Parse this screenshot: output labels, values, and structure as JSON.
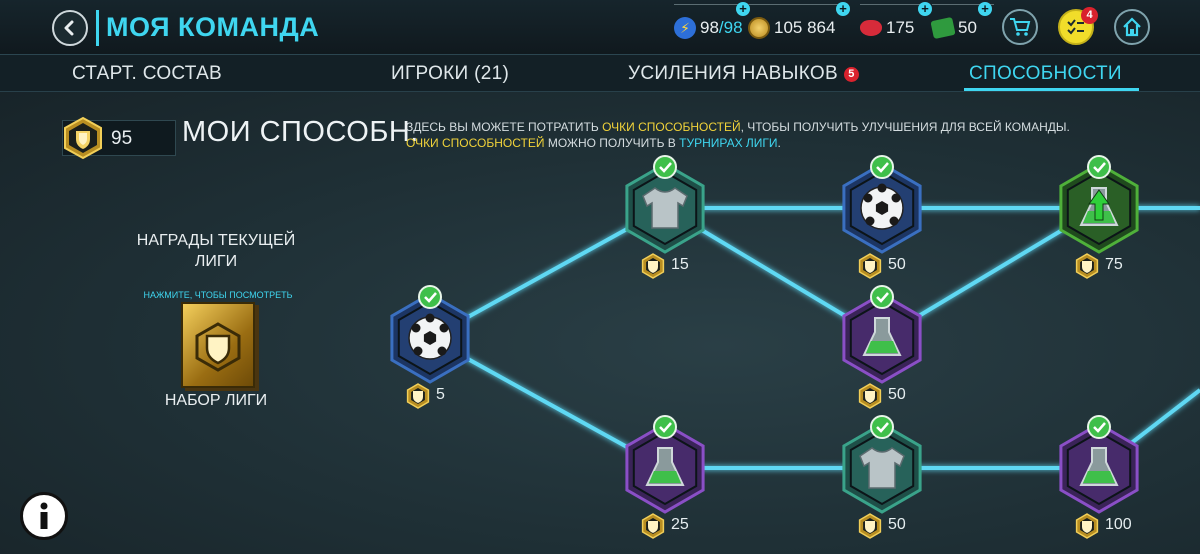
{
  "header": {
    "title": "МОЯ КОМАНДА",
    "energy": "98",
    "energy_max": "/98",
    "coins": "105 864",
    "gems": "175",
    "cash": "50",
    "notifications_count": "4"
  },
  "tabs": {
    "starting_lineup": "СТАРТ. СОСТАВ",
    "players": "ИГРОКИ (21)",
    "skill_boosts": "УСИЛЕНИЯ НАВЫКОВ",
    "skill_boosts_badge": "5",
    "abilities": "СПОСОБНОСТИ"
  },
  "abilities_header": {
    "points": "95",
    "title": "МОИ СПОСОБН.",
    "desc_line1_a": "ЗДЕСЬ ВЫ МОЖЕТЕ ПОТРАТИТЬ ",
    "desc_line1_highlight": "ОЧКИ СПОСОБНОСТЕЙ",
    "desc_line1_b": ", ЧТОБЫ ПОЛУЧИТЬ УЛУЧШЕНИЯ ДЛЯ ВСЕЙ КОМАНДЫ.",
    "desc_line2_highlight": "ОЧКИ СПОСОБНОСТЕЙ",
    "desc_line2_a": " МОЖНО ПОЛУЧИТЬ В ",
    "desc_line2_link": "ТУРНИРАХ ЛИГИ",
    "desc_line2_end": "."
  },
  "rewards": {
    "title": "НАГРАДЫ ТЕКУЩЕЙ ЛИГИ",
    "hint": "НАЖМИТЕ, ЧТОБЫ ПОСМОТРЕТЬ",
    "pack_label": "НАБОР ЛИГИ"
  },
  "nodes": [
    {
      "id": "n1",
      "icon": "ball-icon",
      "color": "blue",
      "cost": "5",
      "unlocked": true
    },
    {
      "id": "n2",
      "icon": "jersey-icon",
      "color": "teal",
      "cost": "15",
      "unlocked": true
    },
    {
      "id": "n3",
      "icon": "flask-icon",
      "color": "purple",
      "cost": "25",
      "unlocked": true
    },
    {
      "id": "n4",
      "icon": "ball-icon",
      "color": "blue",
      "cost": "50",
      "unlocked": true
    },
    {
      "id": "n5",
      "icon": "flask-icon",
      "color": "purple",
      "cost": "50",
      "unlocked": true
    },
    {
      "id": "n6",
      "icon": "jersey-icon",
      "color": "teal",
      "cost": "50",
      "unlocked": true
    },
    {
      "id": "n7",
      "icon": "flask-arrow-icon",
      "color": "green",
      "cost": "75",
      "unlocked": true
    },
    {
      "id": "n8",
      "icon": "flask-icon",
      "color": "purple",
      "cost": "100",
      "unlocked": true
    }
  ],
  "colors": {
    "accent": "#3fd6f0",
    "highlight": "#f0d23a",
    "check": "#3fbf4a"
  }
}
